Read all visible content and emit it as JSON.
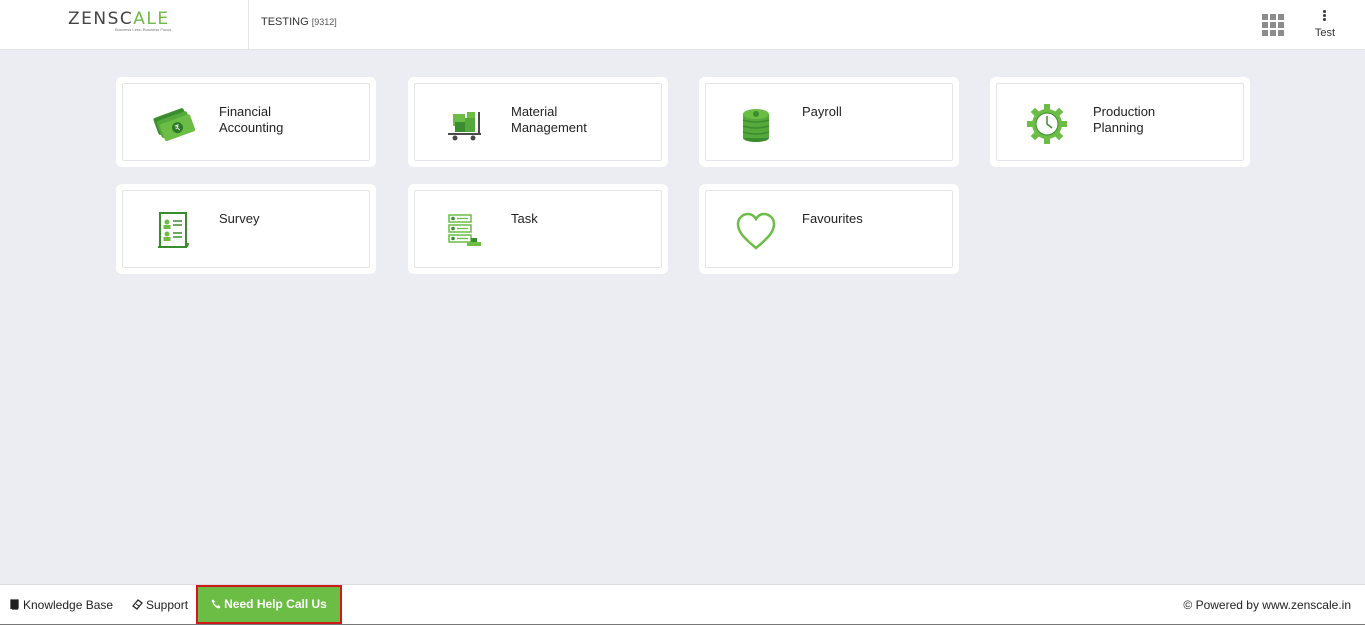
{
  "header": {
    "logo": {
      "text_main": "ZENSC",
      "text_accent": "A",
      "text_end": "LE",
      "tagline": "Business Less. Business Focus."
    },
    "company_name": "TESTING",
    "company_code": "[9312]",
    "apps_icon": "grid-icon",
    "user": {
      "name": "Test",
      "menu_icon": "kebab-icon"
    }
  },
  "modules": [
    {
      "label_line1": "Financial",
      "label_line2": "Accounting",
      "icon": "money-icon"
    },
    {
      "label_line1": "Material",
      "label_line2": "Management",
      "icon": "trolley-icon"
    },
    {
      "label_line1": "Payroll",
      "label_line2": "",
      "icon": "coins-icon"
    },
    {
      "label_line1": "Production",
      "label_line2": "Planning",
      "icon": "gear-clock-icon"
    },
    {
      "label_line1": "Survey",
      "label_line2": "",
      "icon": "survey-doc-icon"
    },
    {
      "label_line1": "Task",
      "label_line2": "",
      "icon": "task-list-icon"
    },
    {
      "label_line1": "Favourites",
      "label_line2": "",
      "icon": "heart-icon"
    }
  ],
  "footer": {
    "knowledge_base": "Knowledge Base",
    "support": "Support",
    "help_button": "Need Help Call Us",
    "powered_by": "© Powered by www.zenscale.in"
  },
  "colors": {
    "accent": "#6cbd45",
    "icon_dark": "#3a8d2f",
    "background": "#ecedf2",
    "highlight": "#d01a1a"
  }
}
